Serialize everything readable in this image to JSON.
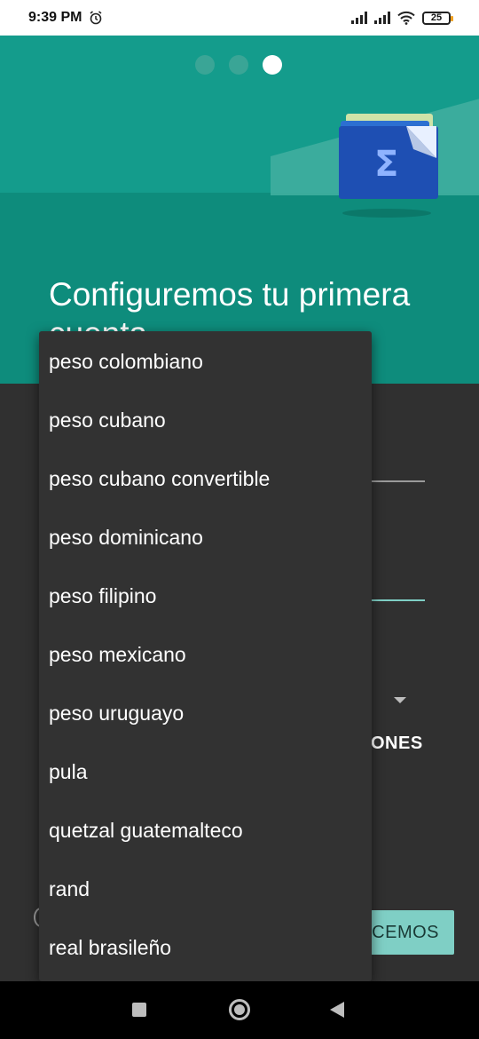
{
  "status_bar": {
    "time": "9:39 PM",
    "battery": "25"
  },
  "header": {
    "title": "Configuremos tu primera",
    "title_peek": "cuenta",
    "page_indicator": {
      "total": 3,
      "active": 3
    }
  },
  "form": {
    "options_label": "ONES",
    "continue_label": "CEMOS"
  },
  "currency_list": {
    "items": [
      "peso colombiano",
      "peso cubano",
      "peso cubano convertible",
      "peso dominicano",
      "peso filipino",
      "peso mexicano",
      "peso uruguayo",
      "pula",
      "quetzal guatemalteco",
      "rand",
      "real brasileño"
    ]
  },
  "colors": {
    "header_top": "#149c8c",
    "header_bottom": "#0e8c7c",
    "accent": "#7fcfc5",
    "popup_bg": "#323232",
    "background": "#303030"
  }
}
